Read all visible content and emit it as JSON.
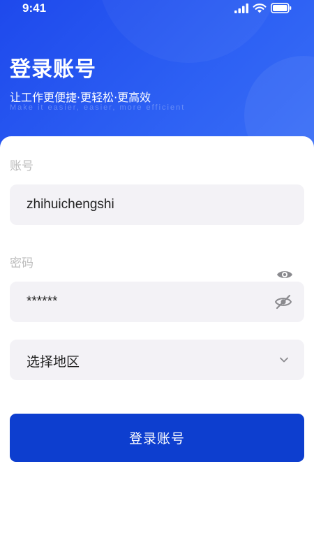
{
  "status_bar": {
    "time": "9:41",
    "icons": [
      "signal-icon",
      "wifi-icon",
      "battery-icon"
    ]
  },
  "header": {
    "title": "登录账号",
    "subtitle": "让工作更便捷·更轻松·更高效",
    "subtitle_en": "Make it easier, easier, more efficient"
  },
  "form": {
    "account": {
      "label": "账号",
      "value": "zhihuichengshi"
    },
    "password": {
      "label": "密码",
      "value": "******",
      "icons": [
        "eye-icon",
        "eye-off-icon"
      ]
    },
    "region": {
      "placeholder": "选择地区",
      "icon": "chevron-down-icon"
    },
    "submit_label": "登录账号"
  },
  "colors": {
    "header_start": "#1e49ec",
    "header_end": "#3a6ff7",
    "primary_button": "#0d3ecf",
    "input_background": "#f3f2f6",
    "label_gray": "#bdbdbd",
    "icon_gray": "#8a8a8e"
  }
}
